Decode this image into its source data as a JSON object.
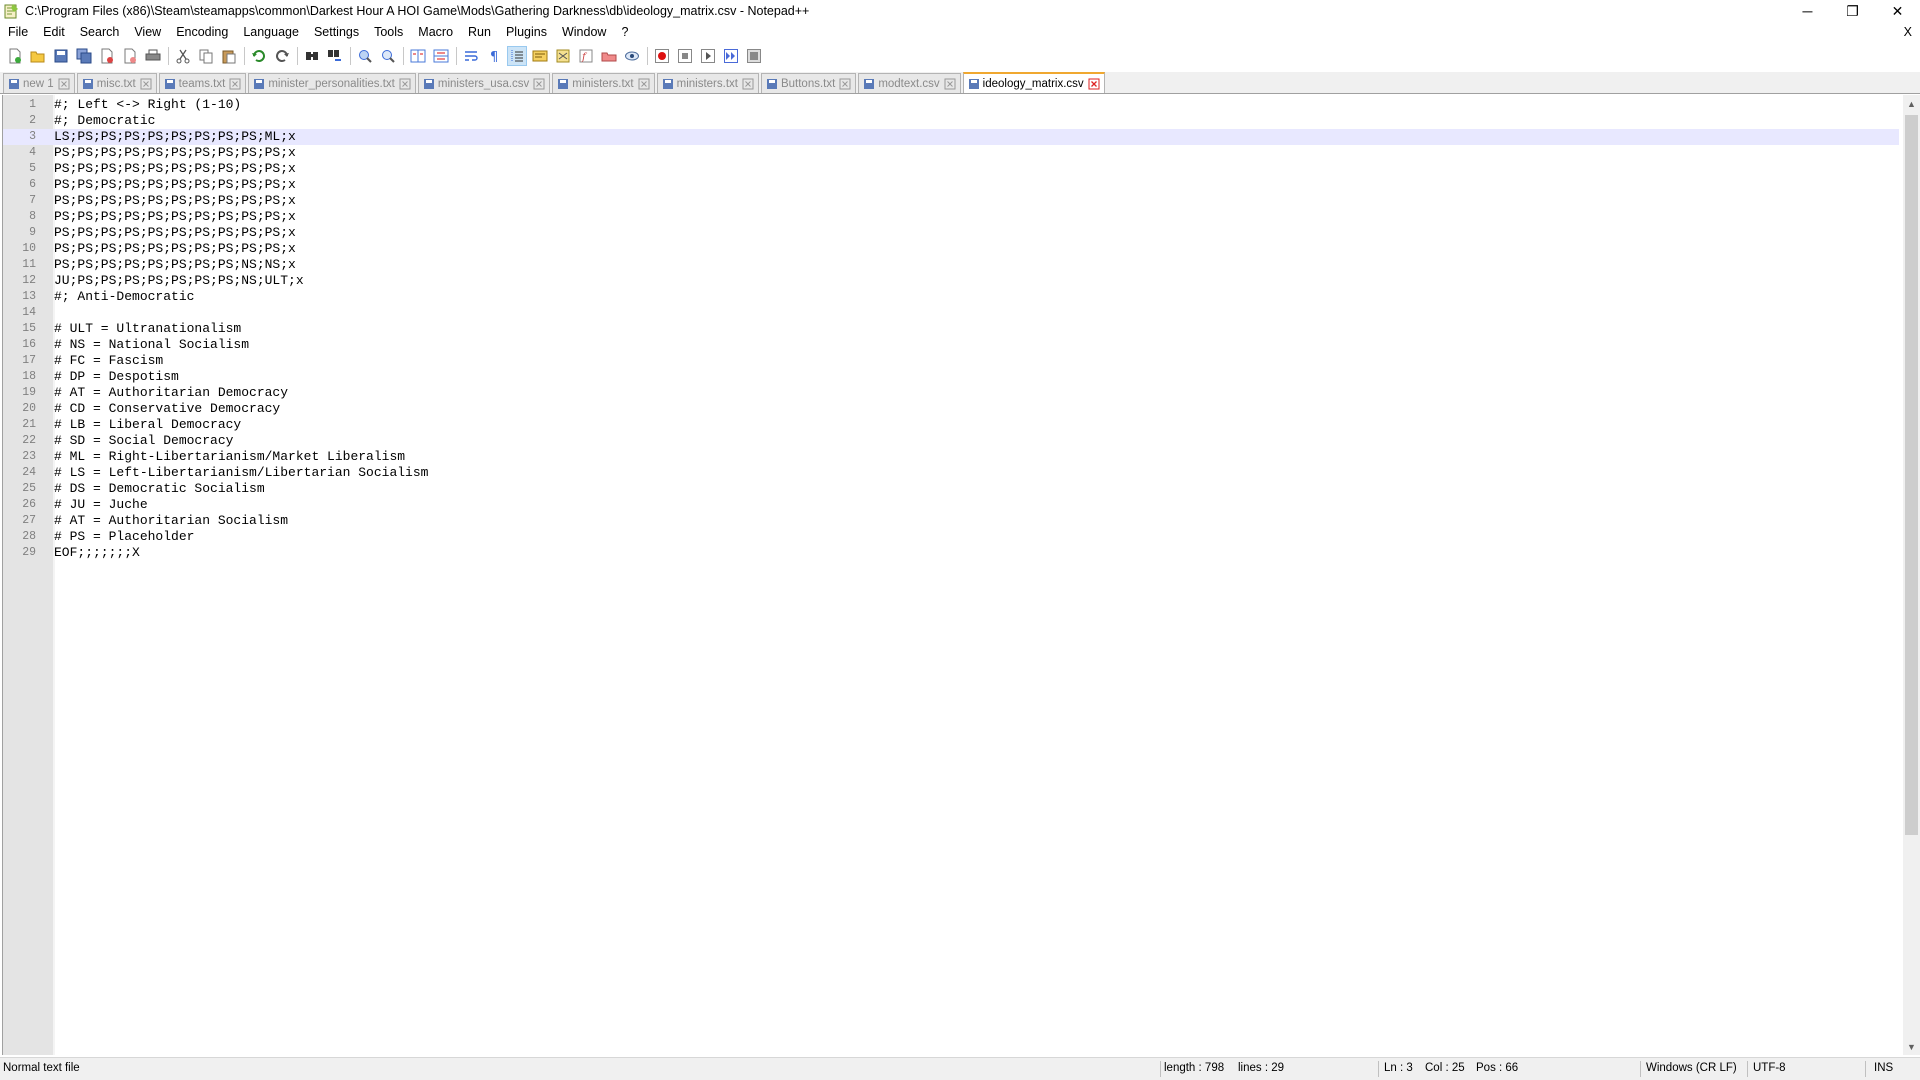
{
  "window": {
    "title": "C:\\Program Files (x86)\\Steam\\steamapps\\common\\Darkest Hour A HOI Game\\Mods\\Gathering Darkness\\db\\ideology_matrix.csv - Notepad++",
    "icon": "notepad-plus-plus-icon",
    "minimize_label": "─",
    "restore_label": "❐",
    "close_label": "✕"
  },
  "menu": {
    "items": [
      "File",
      "Edit",
      "Search",
      "View",
      "Encoding",
      "Language",
      "Settings",
      "Tools",
      "Macro",
      "Run",
      "Plugins",
      "Window",
      "?"
    ],
    "close_label": "X"
  },
  "toolbar": {
    "buttons": [
      "new-file-icon",
      "open-file-icon",
      "save-icon",
      "save-all-icon",
      "close-icon",
      "close-all-icon",
      "print-icon",
      "cut-icon",
      "copy-icon",
      "paste-icon",
      "undo-icon",
      "redo-icon",
      "find-icon",
      "replace-icon",
      "zoom-in-icon",
      "zoom-out-icon",
      "sync-vertical-icon",
      "sync-horizontal-icon",
      "word-wrap-icon",
      "show-all-characters-icon",
      "indent-guide-icon",
      "user-language-icon",
      "document-map-icon",
      "function-list-icon",
      "folder-as-workspace-icon",
      "monitoring-icon",
      "record-macro-icon",
      "stop-macro-icon",
      "play-macro-icon",
      "run-macro-multiple-icon",
      "save-macro-icon"
    ]
  },
  "tabs": [
    {
      "label": "new 1",
      "active": false
    },
    {
      "label": "misc.txt",
      "active": false
    },
    {
      "label": "teams.txt",
      "active": false
    },
    {
      "label": "minister_personalities.txt",
      "active": false
    },
    {
      "label": "ministers_usa.csv",
      "active": false
    },
    {
      "label": "ministers.txt",
      "active": false
    },
    {
      "label": "ministers.txt",
      "active": false
    },
    {
      "label": "Buttons.txt",
      "active": false
    },
    {
      "label": "modtext.csv",
      "active": false
    },
    {
      "label": "ideology_matrix.csv",
      "active": true
    }
  ],
  "editor": {
    "current_line": 3,
    "lines": [
      {
        "n": "1",
        "text": "#; Left <-> Right (1-10)"
      },
      {
        "n": "2",
        "text": "#; Democratic"
      },
      {
        "n": "3",
        "text": "LS;PS;PS;PS;PS;PS;PS;PS;PS;ML;x"
      },
      {
        "n": "4",
        "text": "PS;PS;PS;PS;PS;PS;PS;PS;PS;PS;x"
      },
      {
        "n": "5",
        "text": "PS;PS;PS;PS;PS;PS;PS;PS;PS;PS;x"
      },
      {
        "n": "6",
        "text": "PS;PS;PS;PS;PS;PS;PS;PS;PS;PS;x"
      },
      {
        "n": "7",
        "text": "PS;PS;PS;PS;PS;PS;PS;PS;PS;PS;x"
      },
      {
        "n": "8",
        "text": "PS;PS;PS;PS;PS;PS;PS;PS;PS;PS;x"
      },
      {
        "n": "9",
        "text": "PS;PS;PS;PS;PS;PS;PS;PS;PS;PS;x"
      },
      {
        "n": "10",
        "text": "PS;PS;PS;PS;PS;PS;PS;PS;PS;PS;x"
      },
      {
        "n": "11",
        "text": "PS;PS;PS;PS;PS;PS;PS;PS;NS;NS;x"
      },
      {
        "n": "12",
        "text": "JU;PS;PS;PS;PS;PS;PS;PS;NS;ULT;x"
      },
      {
        "n": "13",
        "text": "#; Anti-Democratic"
      },
      {
        "n": "14",
        "text": ""
      },
      {
        "n": "15",
        "text": "# ULT = Ultranationalism"
      },
      {
        "n": "16",
        "text": "# NS = National Socialism"
      },
      {
        "n": "17",
        "text": "# FC = Fascism"
      },
      {
        "n": "18",
        "text": "# DP = Despotism"
      },
      {
        "n": "19",
        "text": "# AT = Authoritarian Democracy"
      },
      {
        "n": "20",
        "text": "# CD = Conservative Democracy"
      },
      {
        "n": "21",
        "text": "# LB = Liberal Democracy"
      },
      {
        "n": "22",
        "text": "# SD = Social Democracy"
      },
      {
        "n": "23",
        "text": "# ML = Right-Libertarianism/Market Liberalism"
      },
      {
        "n": "24",
        "text": "# LS = Left-Libertarianism/Libertarian Socialism"
      },
      {
        "n": "25",
        "text": "# DS = Democratic Socialism"
      },
      {
        "n": "26",
        "text": "# JU = Juche"
      },
      {
        "n": "27",
        "text": "# AT = Authoritarian Socialism"
      },
      {
        "n": "28",
        "text": "# PS = Placeholder"
      },
      {
        "n": "29",
        "text": "EOF;;;;;;;X"
      }
    ]
  },
  "statusbar": {
    "file_type": "Normal text file",
    "length": "length : 798",
    "lines": "lines : 29",
    "ln": "Ln : 3",
    "col": "Col : 25",
    "pos": "Pos : 66",
    "eol": "Windows (CR LF)",
    "encoding": "UTF-8",
    "mode": "INS"
  },
  "colors": {
    "tab_active_accent": "#f0a830",
    "current_line": "#e8e8ff",
    "gutter": "#e4e4e4"
  }
}
